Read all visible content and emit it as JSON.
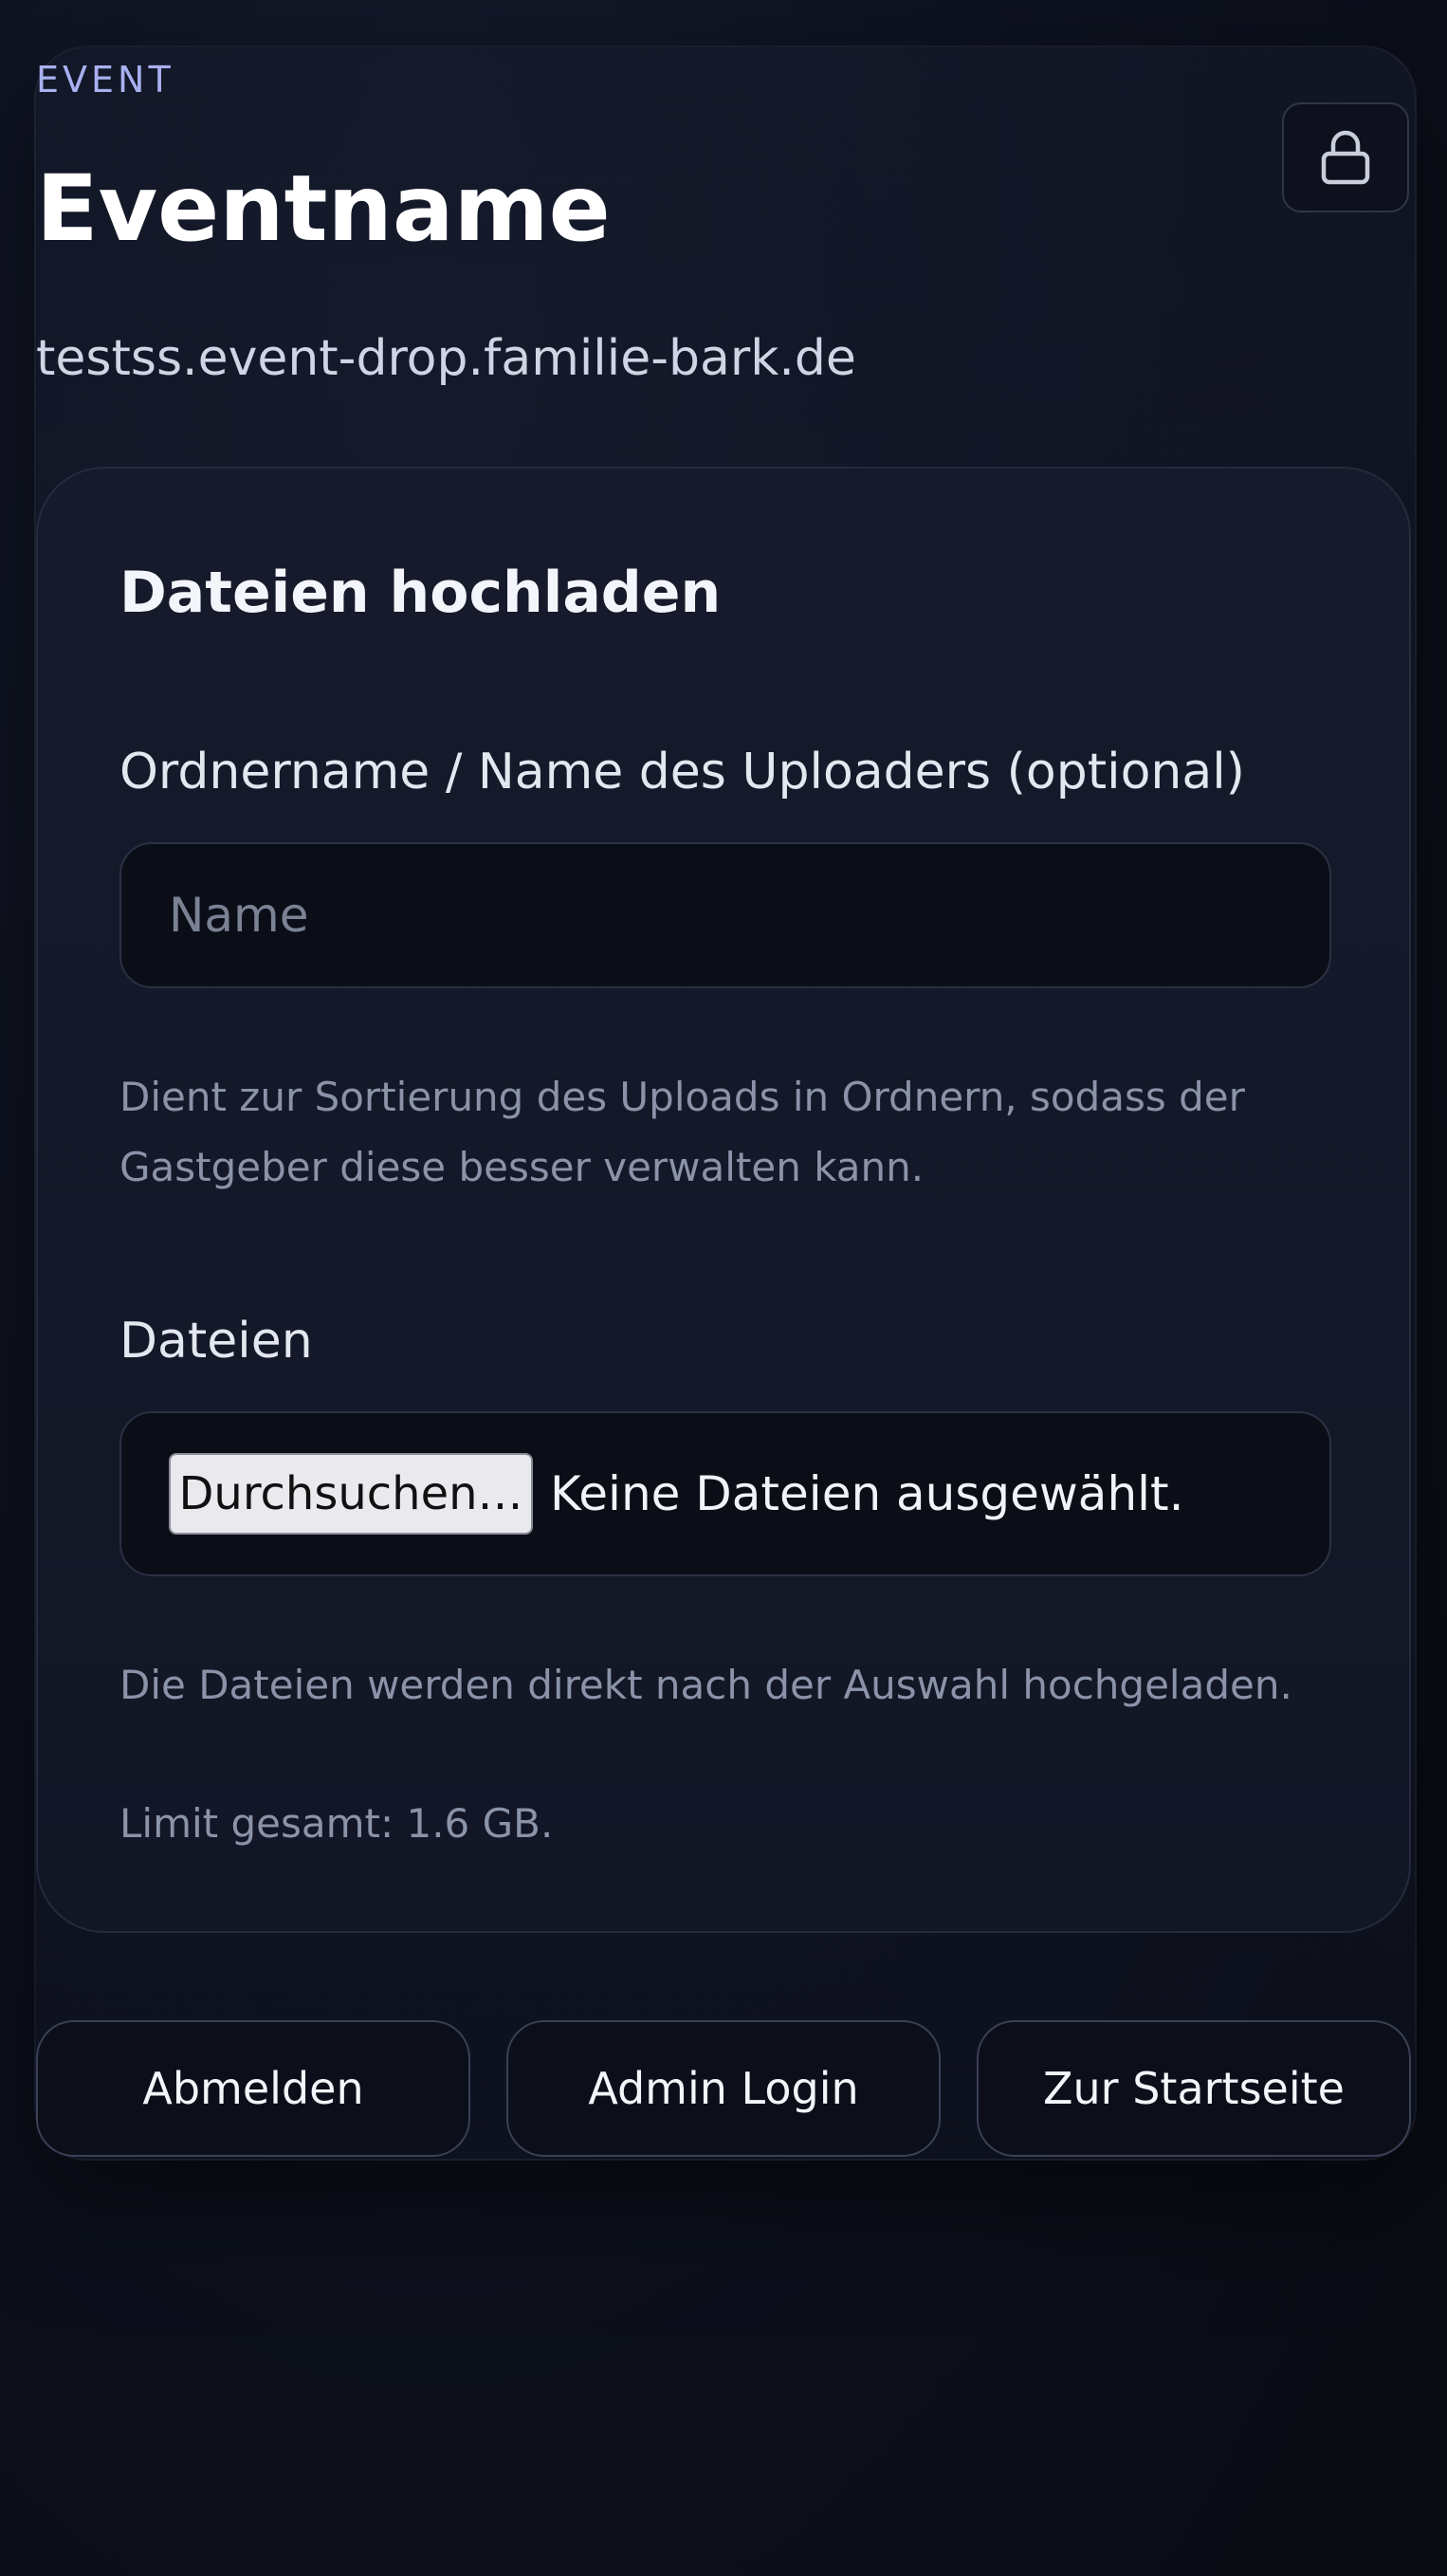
{
  "header": {
    "eyebrow": "EVENT",
    "title": "Eventname",
    "subdomain": "testss.event-drop.familie-bark.de",
    "lock_icon": "lock-icon"
  },
  "upload": {
    "title": "Dateien hochladen",
    "name_field": {
      "label": "Ordnername / Name des Uploaders (optional)",
      "placeholder": "Name",
      "value": "",
      "hint": "Dient zur Sortierung des Uploads in Ordnern, sodass der Gastgeber diese besser verwalten kann."
    },
    "files_field": {
      "label": "Dateien",
      "browse_label": "Durchsuchen…",
      "status": "Keine Dateien ausgewählt.",
      "hint": "Die Dateien werden direkt nach der Auswahl hochgeladen.",
      "limit": "Limit gesamt: 1.6 GB."
    }
  },
  "actions": {
    "logout": "Abmelden",
    "admin_login": "Admin Login",
    "home": "Zur Startseite"
  },
  "colors": {
    "background": "#0e1220",
    "card": "#141929",
    "accent_eyebrow": "#a8b0f0",
    "input_bg": "#0b0e17",
    "hint_text": "#8b93a8"
  }
}
